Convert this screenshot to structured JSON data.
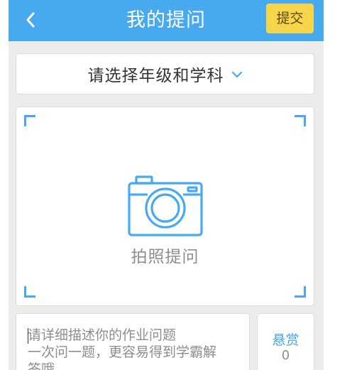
{
  "header": {
    "title": "我的提问",
    "submit_label": "提交",
    "back_icon": "chevron-left-icon"
  },
  "selector": {
    "label": "请选择年级和学科",
    "icon": "chevron-down-icon"
  },
  "photo": {
    "label": "拍照提问",
    "icon": "camera-icon"
  },
  "description": {
    "lines": [
      "请详细描述你的作业问题",
      "一次问一题，更容易得到学霸解",
      "答哦"
    ]
  },
  "reward": {
    "label": "悬赏",
    "value": "0"
  },
  "colors": {
    "accent": "#47a9ee",
    "submit_bg": "#f7d54a",
    "page_bg": "#ececec"
  }
}
